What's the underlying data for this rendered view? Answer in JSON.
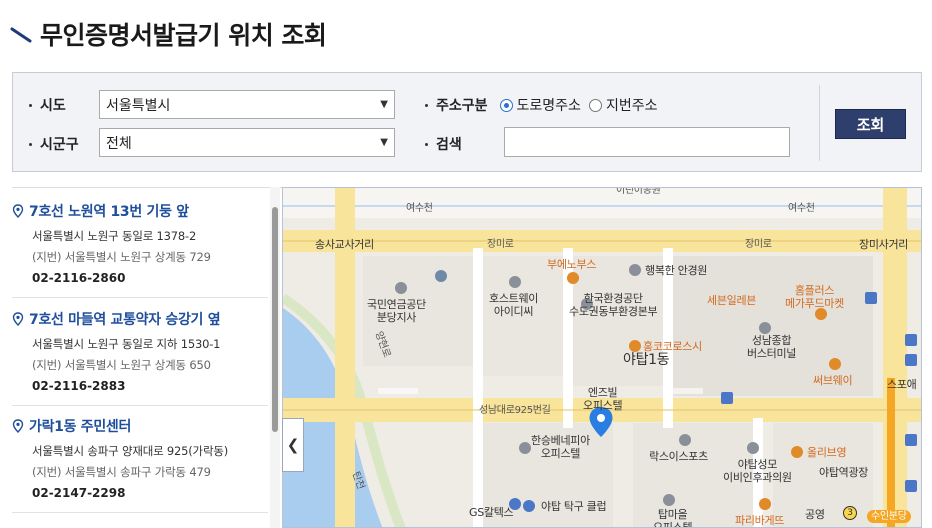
{
  "page": {
    "title": "무인증명서발급기 위치 조회"
  },
  "search": {
    "sido_label": "시도",
    "sido_value": "서울특별시",
    "sigungu_label": "시군구",
    "sigungu_value": "전체",
    "address_type_label": "주소구분",
    "address_options": [
      "도로명주소",
      "지번주소"
    ],
    "address_selected": "도로명주소",
    "keyword_label": "검색",
    "keyword_value": "",
    "button_label": "조회"
  },
  "results": [
    {
      "name": "7호선 노원역 13번 기둥 앞",
      "road": "서울특별시 노원구 동일로 1378-2",
      "jibun": "(지번) 서울특별시 노원구 상계동 729",
      "phone": "02-2116-2860"
    },
    {
      "name": "7호선 마들역 교통약자 승강기 옆",
      "road": "서울특별시 노원구 동일로 지하 1530-1",
      "jibun": "(지번) 서울특별시 노원구 상계동 650",
      "phone": "02-2116-2883"
    },
    {
      "name": "가락1동 주민센터",
      "road": "서울특별시 송파구 양재대로 925(가락동)",
      "jibun": "(지번) 서울특별시 송파구 가락동 479",
      "phone": "02-2147-2298"
    }
  ],
  "map": {
    "labels": {
      "top_partial": "이린이공원",
      "stream_left": "여수천",
      "stream_right": "여수천",
      "intersection_left": "송사교사거리",
      "road_jangmi1": "장미로",
      "road_jangmi2": "장미로",
      "intersection_right": "장미사거리",
      "bunny": "부에노부스",
      "happy": "행복한 안경원",
      "pension": "국민연금공단\n분당지사",
      "hostway": "호스트웨이\n아이디씨",
      "env": "한국환경공단\n수도권동부환경본부",
      "homeplus": "홈플러스\n메가푸드마켓",
      "seven": "세븐일레븐",
      "terminal": "성남종합\n버스터미널",
      "hongko": "홍코코로스시",
      "yatap1": "야탑1동",
      "subway": "써브웨이",
      "stream_vertical": "양현로",
      "enzel": "엔즈빌\n오피스텔",
      "seongnam_road": "성남대로925번길",
      "hanseung": "한승베네피아\n오피스텔",
      "laxis": "락스이스포츠",
      "olive": "올리브영",
      "sungmo": "야탑성모\n이비인후과의원",
      "yatap_square": "야탑역광장",
      "spoae": "스포애",
      "tan_stream": "탄천",
      "gs": "GS칼텍스",
      "pingpong": "야탑 탁구 클럽",
      "tapmaeul": "탑마을\n오피스텔",
      "paris": "파리바게뜨",
      "park": "공영",
      "line_badge": "수인분당",
      "exit_no": "3"
    }
  }
}
